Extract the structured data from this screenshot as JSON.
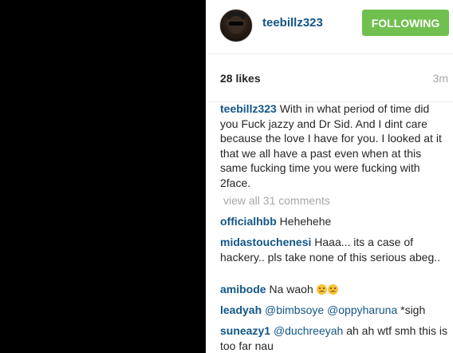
{
  "post": {
    "username": "teebillz323",
    "follow_label": "FOLLOWING",
    "likes": "28 likes",
    "time": "3m",
    "caption": {
      "author": "teebillz323",
      "text": "With in what period of time did you Fuck jazzy and Dr Sid. And I dint care because the love I have for you. I looked at it that we all have a past even when at this same fucking time you were fucking with 2face."
    },
    "view_all_label": "view all 31 comments",
    "comments": [
      {
        "author": "officialhbb",
        "text": "Hehehehe"
      },
      {
        "author": "midastouchenesi",
        "text": "Haaa... its a case of hackery.. pls take none of this serious abeg.."
      },
      {
        "author": "amibode",
        "text": "Na waoh",
        "emoji": "weary-face-icon"
      },
      {
        "author": "leadyah",
        "mentions": [
          "@bimbsoye",
          "@oppyharuna"
        ],
        "text": "*sigh"
      },
      {
        "author": "suneazy1",
        "mentions": [
          "@duchreeyah"
        ],
        "text": "ah ah wtf smh this is too far nau"
      }
    ]
  },
  "colors": {
    "username": "#125688",
    "follow_button": "#70c050",
    "muted_text": "#a5a7aa",
    "media_background": "#000000"
  }
}
